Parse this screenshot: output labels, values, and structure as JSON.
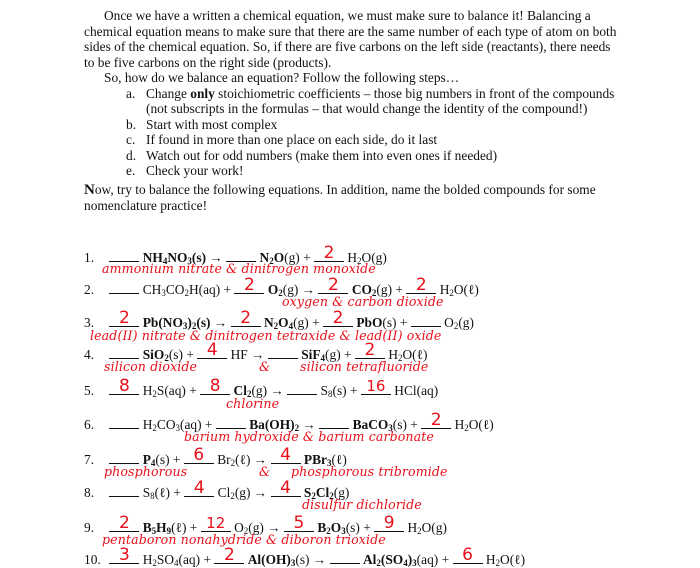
{
  "intro": {
    "p1": "Once we have a written a chemical equation, we must make sure to balance it!  Balancing a chemical equation means to make sure that there are the same number of each type of atom on both sides of the chemical equation.  So, if there are five carbons on the left side (reactants), there needs to be five carbons on the right side (products).",
    "p2": "So, how do we balance an equation?  Follow the following steps…",
    "steps": [
      {
        "label": "a.",
        "pre": "Change ",
        "bold": "only",
        "post": " stoichiometric coefficients – those big numbers in front of the compounds (not subscripts in the formulas – that would change the identity of the compound!)"
      },
      {
        "label": "b.",
        "text": "Start with most complex"
      },
      {
        "label": "c.",
        "text": "If found in more than one place on each side, do it last"
      },
      {
        "label": "d.",
        "text": "Watch out for odd numbers (make them into even ones if needed)"
      },
      {
        "label": "e.",
        "text": "Check your work!"
      }
    ],
    "now_cap": "N",
    "now_text": "ow, try to balance the following equations.  In addition, name the bolded compounds for some nomenclature practice!"
  },
  "equations": [
    {
      "number": "1.",
      "coefficients": [
        "",
        "",
        "2"
      ],
      "answer_names": "ammonium nitrate  &  dinitrogen monoxide"
    },
    {
      "number": "2.",
      "coefficients": [
        "",
        "2",
        "2",
        "2"
      ],
      "answer_names": "oxygen  &  carbon dioxide"
    },
    {
      "number": "3.",
      "coefficients": [
        "2",
        "2",
        "2",
        ""
      ],
      "answer_names": "lead(II) nitrate  &  dinitrogen tetraxide  &  lead(II) oxide"
    },
    {
      "number": "4.",
      "coefficients": [
        "",
        "4",
        "",
        "2"
      ],
      "answer_names": [
        "silicon dioxide",
        "&",
        "silicon tetrafluoride"
      ]
    },
    {
      "number": "5.",
      "coefficients": [
        "8",
        "8",
        "",
        "16"
      ],
      "answer_names": "chlorine"
    },
    {
      "number": "6.",
      "coefficients": [
        "",
        "",
        "",
        "2"
      ],
      "answer_names": "barium hydroxide   &   barium carbonate"
    },
    {
      "number": "7.",
      "coefficients": [
        "",
        "6",
        "4"
      ],
      "answer_names": [
        "phosphorous",
        "&",
        "phosphorous tribromide"
      ]
    },
    {
      "number": "8.",
      "coefficients": [
        "",
        "4",
        "4"
      ],
      "answer_names": "disulfur dichloride"
    },
    {
      "number": "9.",
      "coefficients": [
        "2",
        "12",
        "5",
        "9"
      ],
      "answer_names": "pentaboron nonahydride  &  diboron trioxide"
    },
    {
      "number": "10.",
      "coefficients": [
        "3",
        "2",
        "",
        "6"
      ]
    }
  ],
  "symbols": {
    "arrow": "→",
    "plus": "+"
  }
}
